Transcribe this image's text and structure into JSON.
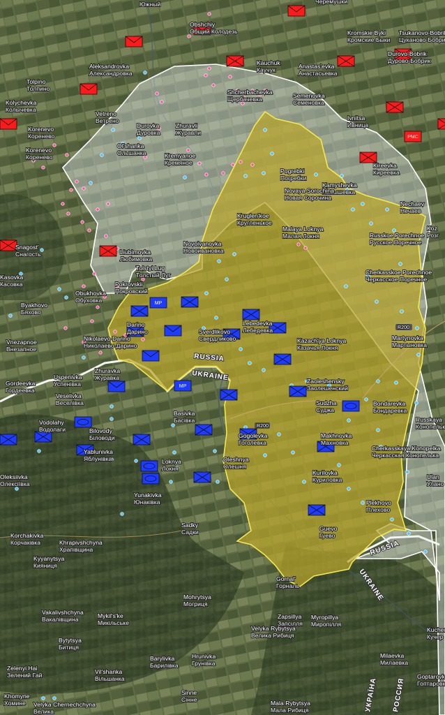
{
  "colors": {
    "terrain_dark": "#3b4a2b",
    "terrain_field": "#6f7a52",
    "russian_unit": "#ff1a1a",
    "ukrainian_unit": "#1d3cff",
    "ukraine_control_fill": "#b5a22a",
    "ukraine_control_border": "#f2e64a",
    "contested_fill": "#d9dee6",
    "contested_border": "#ffffff",
    "point_blue": "#4ec3ff",
    "point_pink": "#ff4fa3"
  },
  "border_labels": {
    "russia_west": "RUSSIA",
    "ukraine_west": "UKRAINE",
    "russia_east": "RUSSIA",
    "ukraine_east": "UKRAINE",
    "ukraina_vertical": "УКРАЇНА",
    "rossiya_vertical": "РОССИЯ"
  },
  "roads": {
    "r200_east": "R200",
    "r200_center": "R200"
  },
  "unit_badges": {
    "mp": "MP",
    "pmc": "PMC"
  },
  "places": [
    {
      "id": "yuzhny",
      "en": "",
      "ru": "Южный"
    },
    {
      "id": "cheremushki",
      "en": "",
      "ru": "Черемушки"
    },
    {
      "id": "obshchiy",
      "en": "Obshchiy",
      "ru": "Общий Колодезь"
    },
    {
      "id": "kromskie",
      "en": "Kromskie Byki",
      "ru": "Кромские Быки"
    },
    {
      "id": "tsukanovo",
      "en": "Tsukanovo-Bobrik",
      "ru": "Цуканово-Бобрик"
    },
    {
      "id": "aleksandrovka",
      "en": "Aleksandrovka",
      "ru": "Александровка"
    },
    {
      "id": "kauchuk",
      "en": "Kauchuk",
      "ru": "Каучук"
    },
    {
      "id": "anastasevka",
      "en": "Anastas'evka",
      "ru": "Анастасьевка"
    },
    {
      "id": "durovo",
      "en": "Durovo-Bobrik",
      "ru": "Дурово-Бобрик"
    },
    {
      "id": "tolpino",
      "en": "Tolpino",
      "ru": "Толпино"
    },
    {
      "id": "shcherbachevka",
      "en": "Shcherbachevka",
      "ru": "Щербачевка"
    },
    {
      "id": "semenovka",
      "en": "Semenovka",
      "ru": "Семеновка"
    },
    {
      "id": "kolychevka",
      "en": "Kolychevka",
      "ru": "Колычевка"
    },
    {
      "id": "vetreno",
      "en": "Vetreno",
      "ru": "Ветрено"
    },
    {
      "id": "ivnitsa",
      "en": "Ivnitsa",
      "ru": "Ивница"
    },
    {
      "id": "korenevo1",
      "en": "Korenevo",
      "ru": "Коренево"
    },
    {
      "id": "durovka",
      "en": "Durovka",
      "ru": "Дуровка"
    },
    {
      "id": "zhuravli",
      "en": "Zhuravli",
      "ru": "Журавли"
    },
    {
      "id": "olshanka",
      "en": "Ol'shanka",
      "ru": "Ольшанка"
    },
    {
      "id": "korenevo2",
      "en": "Korenevo",
      "ru": "Коренево"
    },
    {
      "id": "kremyanoe",
      "en": "Kremyanoe",
      "ru": "Кремяное"
    },
    {
      "id": "kireevka",
      "en": "Kireevka",
      "ru": "Киреевка"
    },
    {
      "id": "pogrebki",
      "en": "Pogrebki",
      "ru": "Погребки"
    },
    {
      "id": "kamyshevka",
      "en": "Kamyshevka",
      "ru": "Камышевка"
    },
    {
      "id": "novaya_sorochina",
      "en": "Novaya Sorochina",
      "ru": "Новая Сорочина"
    },
    {
      "id": "nechaev",
      "en": "Nechaev",
      "ru": "Нечаев"
    },
    {
      "id": "kruglenkoe",
      "en": "Kruglen'koe",
      "ru": "Кругленькое"
    },
    {
      "id": "koz",
      "en": "Koz",
      "ru": "Розг"
    },
    {
      "id": "malaya_loknya",
      "en": "Malaya Loknya",
      "ru": "Малая Локня"
    },
    {
      "id": "russkoe_porechnoe",
      "en": "Russkoe Porechnoe",
      "ru": "Русское Поречное"
    },
    {
      "id": "novoivanovka",
      "en": "Novoivanovka",
      "ru": "Новоивановка"
    },
    {
      "id": "snagost",
      "en": "Snagost'",
      "ru": "Снагость"
    },
    {
      "id": "liubimovka",
      "en": "Liubimovka",
      "ru": "Любимовка"
    },
    {
      "id": "tolstyi_lug",
      "en": "Tolstyi Lug",
      "ru": "Толстый Луг"
    },
    {
      "id": "cherkasskoe_porechnoe",
      "en": "Cherkasskoe Porechnoe",
      "ru": "Черкасское Поречное"
    },
    {
      "id": "pokrovskii",
      "en": "Pokrovskii",
      "ru": "Покровский"
    },
    {
      "id": "kasovka",
      "en": "Kasovka",
      "ru": "Касовка"
    },
    {
      "id": "obukhovka",
      "en": "Obukhovka",
      "ru": "Обуховка"
    },
    {
      "id": "byakhovo",
      "en": "Byakhovo",
      "ru": "Бяхово"
    },
    {
      "id": "darino",
      "en": "Darino",
      "ru": "Дарино"
    },
    {
      "id": "sverdlikovo",
      "en": "Sverdlikovo",
      "ru": "Свердликово"
    },
    {
      "id": "lebedevka",
      "en": "Lebedevka",
      "ru": "Лебедевка"
    },
    {
      "id": "martynovka",
      "en": "Martynovka",
      "ru": "Мартыновка"
    },
    {
      "id": "kazachya_loknya",
      "en": "Kazach'ya Loknya",
      "ru": "Казачья Локня"
    },
    {
      "id": "vnezapnoe",
      "en": "Vnezapnoe",
      "ru": "Внезапное"
    },
    {
      "id": "nikolaevo_darino",
      "en": "Nikolaevo-Darino",
      "ru": "Николаево-Дарино"
    },
    {
      "id": "zhuravka",
      "en": "Zhuravka",
      "ru": "Журавка"
    },
    {
      "id": "uspenivka",
      "en": "Uspenivka",
      "ru": "Успенівка"
    },
    {
      "id": "zaoleshenskiy",
      "en": "Zaoleshensky",
      "ru": "Заолешенский"
    },
    {
      "id": "bondarevka",
      "en": "Bondarevka",
      "ru": "Бондаревка"
    },
    {
      "id": "gordeevka",
      "en": "Gordeevka",
      "ru": "Гордеевка"
    },
    {
      "id": "sudzha",
      "en": "Sudzha",
      "ru": "Суджа"
    },
    {
      "id": "russkaya",
      "en": "Russkaya",
      "ru": "Конопелька"
    },
    {
      "id": "veselivka",
      "en": "Veselivka",
      "ru": "Веселівка"
    },
    {
      "id": "basivka",
      "en": "Basivka",
      "ru": "Басівка"
    },
    {
      "id": "gogolevka",
      "en": "Gogolevka",
      "ru": "Гоголевка"
    },
    {
      "id": "makhnovka",
      "en": "Makhnovka",
      "ru": "Махновка"
    },
    {
      "id": "vodolahy",
      "en": "Vodolahy",
      "ru": "Водолаги"
    },
    {
      "id": "bilovody",
      "en": "Bilovody",
      "ru": "Біловоди"
    },
    {
      "id": "cherkasskaya_konopelka",
      "en": "Cherkasskaya Konopelka",
      "ru": "Черкасская Конопелька"
    },
    {
      "id": "oleshnya",
      "en": "Oleshnya",
      "ru": "Олешня"
    },
    {
      "id": "yablunivka",
      "en": "Yablunivka",
      "ru": "Яблунівка"
    },
    {
      "id": "loknya",
      "en": "Loknya",
      "ru": "Локня"
    },
    {
      "id": "oleksiivka",
      "en": "Oleksiivka",
      "ru": "Олексіївка"
    },
    {
      "id": "kurilovka",
      "en": "Kurilovka",
      "ru": "Куриловка"
    },
    {
      "id": "ulanok",
      "en": "Ulan",
      "ru": "Улано"
    },
    {
      "id": "yunakivka",
      "en": "Yunakivka",
      "ru": "Юнаківка"
    },
    {
      "id": "plekhovo",
      "en": "Plekhovo",
      "ru": "Плехово"
    },
    {
      "id": "guevo",
      "en": "Guevo",
      "ru": "Гуево"
    },
    {
      "id": "korchakivka",
      "en": "Korchakivka",
      "ru": "Корчаківка"
    },
    {
      "id": "sadky",
      "en": "Sadky",
      "ru": "Садки"
    },
    {
      "id": "khrapivshchyna",
      "en": "Khrapivshchyna",
      "ru": "Храпівщина"
    },
    {
      "id": "kyyanytsya",
      "en": "Kyyanytsya",
      "ru": "Кияниця"
    },
    {
      "id": "gornal",
      "en": "Gornal'",
      "ru": "Горналь"
    },
    {
      "id": "mohrytsya",
      "en": "Mohrytsya",
      "ru": "Могриця"
    },
    {
      "id": "vakalivshchyna",
      "en": "Vakalivshchyna",
      "ru": "Вакалівщина"
    },
    {
      "id": "mykilske",
      "en": "Mykil's'ke",
      "ru": "Микільське"
    },
    {
      "id": "zapsillya",
      "en": "Zapsillya",
      "ru": "Запсілля"
    },
    {
      "id": "myropillya",
      "en": "Myropillya",
      "ru": "Миропілля"
    },
    {
      "id": "kucher",
      "en": "Kucher",
      "ru": "Кучер"
    },
    {
      "id": "bytytsya",
      "en": "Bytytsya",
      "ru": "Битиця"
    },
    {
      "id": "velyka_rybytsya",
      "en": "Velyka Rybytsya",
      "ru": "Велика Рибиця"
    },
    {
      "id": "zelenyi_hai",
      "en": "Zelenyi Hai",
      "ru": "Зелений Гай"
    },
    {
      "id": "barylivka",
      "en": "Barylivka",
      "ru": "Барилівка"
    },
    {
      "id": "hrunivka",
      "en": "Hrunivka",
      "ru": "Грунівка"
    },
    {
      "id": "milaevka",
      "en": "Milaevka",
      "ru": "Милаевка"
    },
    {
      "id": "vilshanka",
      "en": "Vil'shanka",
      "ru": "Вільшанка"
    },
    {
      "id": "goptarovka",
      "en": "Goptarovka",
      "ru": "Гоптаровка"
    },
    {
      "id": "khomyne",
      "en": "Khomyne",
      "ru": "Хомине"
    },
    {
      "id": "sinne",
      "en": "Sinne",
      "ru": "Сінне"
    },
    {
      "id": "chernechchyna",
      "en": "Velyka Chernechchyna",
      "ru": "Велика"
    },
    {
      "id": "mala_rybytsya",
      "en": "Mala Rybytsya",
      "ru": "Мала Рибиця"
    }
  ]
}
